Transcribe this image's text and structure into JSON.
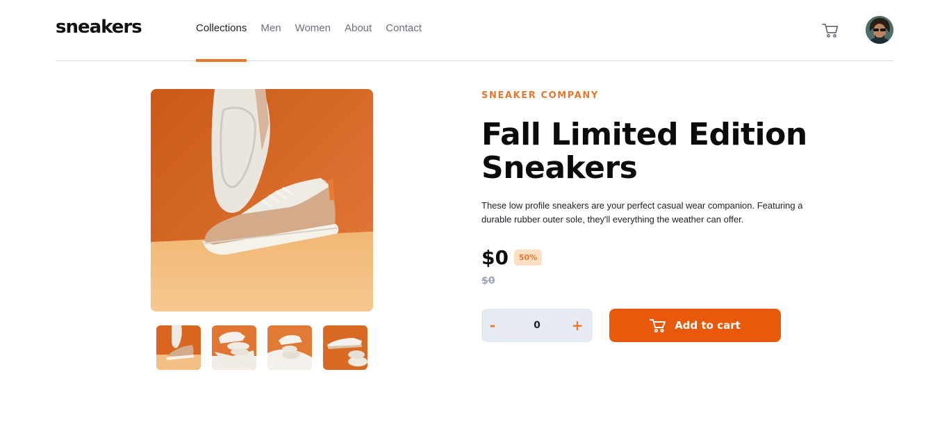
{
  "header": {
    "logo": "sneakers",
    "nav": [
      {
        "label": "Collections",
        "active": true
      },
      {
        "label": "Men"
      },
      {
        "label": "Women"
      },
      {
        "label": "About"
      },
      {
        "label": "Contact"
      }
    ],
    "icons": {
      "cart": "cart-icon",
      "avatar": "user-avatar"
    }
  },
  "product": {
    "company": "SNEAKER COMPANY",
    "title": "Fall Limited Edition Sneakers",
    "description": "These low profile sneakers are your perfect casual wear companion. Featuring a durable rubber outer sole, they'll everything the weather can offer.",
    "price": "$0",
    "discount": "50%",
    "old_price": "$0",
    "quantity": "0",
    "qty_minus": "-",
    "qty_plus": "+",
    "add_to_cart": "Add to cart"
  },
  "colors": {
    "accent": "#e8772e",
    "button": "#e8590c",
    "discount_bg": "#ffe0c2"
  }
}
